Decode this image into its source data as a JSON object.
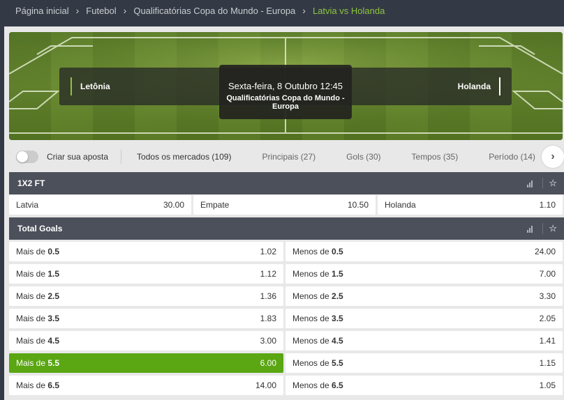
{
  "breadcrumb": {
    "items": [
      "Página inicial",
      "Futebol",
      "Qualificatórias Copa do Mundo - Europa"
    ],
    "current": "Latvia vs Holanda"
  },
  "event": {
    "home_team": "Letônia",
    "away_team": "Holanda",
    "date": "Sexta-feira, 8 Outubro 12:45",
    "competition": "Qualificatórias Copa do Mundo - Europa"
  },
  "toggle_label": "Criar sua aposta",
  "tabs": [
    {
      "label": "Todos os mercados (109)"
    },
    {
      "label": "Principais (27)"
    },
    {
      "label": "Gols (30)"
    },
    {
      "label": "Tempos (35)"
    },
    {
      "label": "Período (14)"
    }
  ],
  "markets": {
    "one_x_two": {
      "title": "1X2 FT",
      "outcomes": [
        {
          "label": "Latvia",
          "odd": "30.00"
        },
        {
          "label": "Empate",
          "odd": "10.50"
        },
        {
          "label": "Holanda",
          "odd": "1.10"
        }
      ]
    },
    "total_goals": {
      "title": "Total Goals",
      "over_prefix": "Mais de",
      "under_prefix": "Menos de",
      "rows": [
        {
          "line": "0.5",
          "over": "1.02",
          "under": "24.00"
        },
        {
          "line": "1.5",
          "over": "1.12",
          "under": "7.00"
        },
        {
          "line": "2.5",
          "over": "1.36",
          "under": "3.30"
        },
        {
          "line": "3.5",
          "over": "1.83",
          "under": "2.05"
        },
        {
          "line": "4.5",
          "over": "3.00",
          "under": "1.41"
        },
        {
          "line": "5.5",
          "over": "6.00",
          "under": "1.15"
        },
        {
          "line": "6.5",
          "over": "14.00",
          "under": "1.05"
        }
      ],
      "selected": "Mais de 5.5"
    }
  },
  "colors": {
    "accent": "#8cc63f",
    "selected": "#5aa613",
    "header": "#4b505a",
    "topbar": "#343a45"
  }
}
